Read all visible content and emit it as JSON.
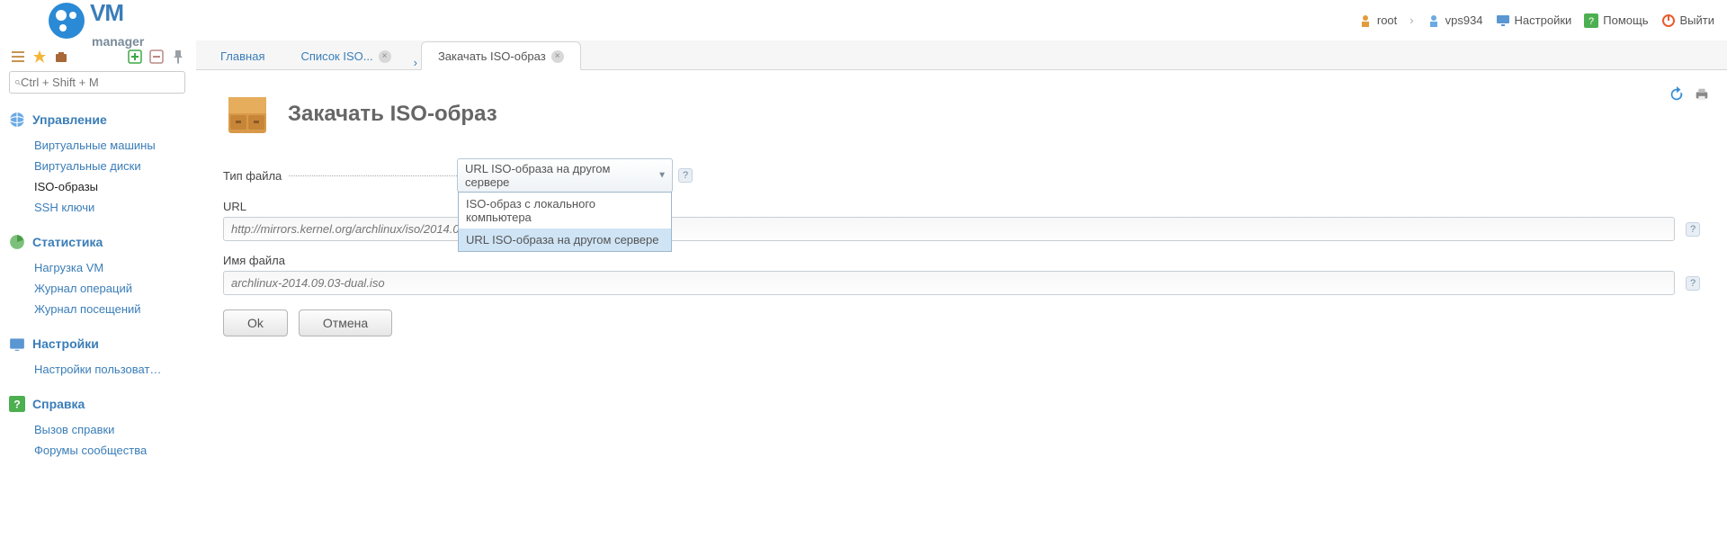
{
  "header": {
    "brand_a": "VM",
    "brand_b": "manager",
    "user1": "root",
    "user2": "vps934",
    "settings": "Настройки",
    "help": "Помощь",
    "logout": "Выйти"
  },
  "search": {
    "placeholder": "Ctrl + Shift + M"
  },
  "toolbar_icons": [
    "list-icon",
    "star-icon",
    "briefcase-icon",
    "plus-icon",
    "minus-icon",
    "pin-icon"
  ],
  "sidebar": [
    {
      "icon": "globe-icon",
      "title": "Управление",
      "items": [
        {
          "label": "Виртуальные машины",
          "active": false
        },
        {
          "label": "Виртуальные диски",
          "active": false
        },
        {
          "label": "ISO-образы",
          "active": true
        },
        {
          "label": "SSH ключи",
          "active": false
        }
      ]
    },
    {
      "icon": "chart-icon",
      "title": "Статистика",
      "items": [
        {
          "label": "Нагрузка VM",
          "active": false
        },
        {
          "label": "Журнал операций",
          "active": false
        },
        {
          "label": "Журнал посещений",
          "active": false
        }
      ]
    },
    {
      "icon": "settings-icon",
      "title": "Настройки",
      "items": [
        {
          "label": "Настройки пользоват…",
          "active": false
        }
      ]
    },
    {
      "icon": "help-icon",
      "title": "Справка",
      "items": [
        {
          "label": "Вызов справки",
          "active": false
        },
        {
          "label": "Форумы сообщества",
          "active": false
        }
      ]
    }
  ],
  "tabs": [
    {
      "label": "Главная",
      "closable": false,
      "kind": "plain"
    },
    {
      "label": "Список ISO...",
      "closable": true,
      "kind": "plain",
      "arrow": true
    },
    {
      "label": "Закачать ISO-образ",
      "closable": true,
      "kind": "active"
    }
  ],
  "page": {
    "title": "Закачать ISO-образ"
  },
  "form": {
    "file_type_label": "Тип файла",
    "file_type_value": "URL ISO-образа на другом сервере",
    "file_type_options": [
      "ISO-образ с локального компьютера",
      "URL ISO-образа на другом сервере"
    ],
    "url_label": "URL",
    "url_placeholder": "http://mirrors.kernel.org/archlinux/iso/2014.09.03/archlinux-2014.09.03-dual.iso",
    "filename_label": "Имя файла",
    "filename_placeholder": "archlinux-2014.09.03-dual.iso",
    "ok": "Ok",
    "cancel": "Отмена"
  }
}
